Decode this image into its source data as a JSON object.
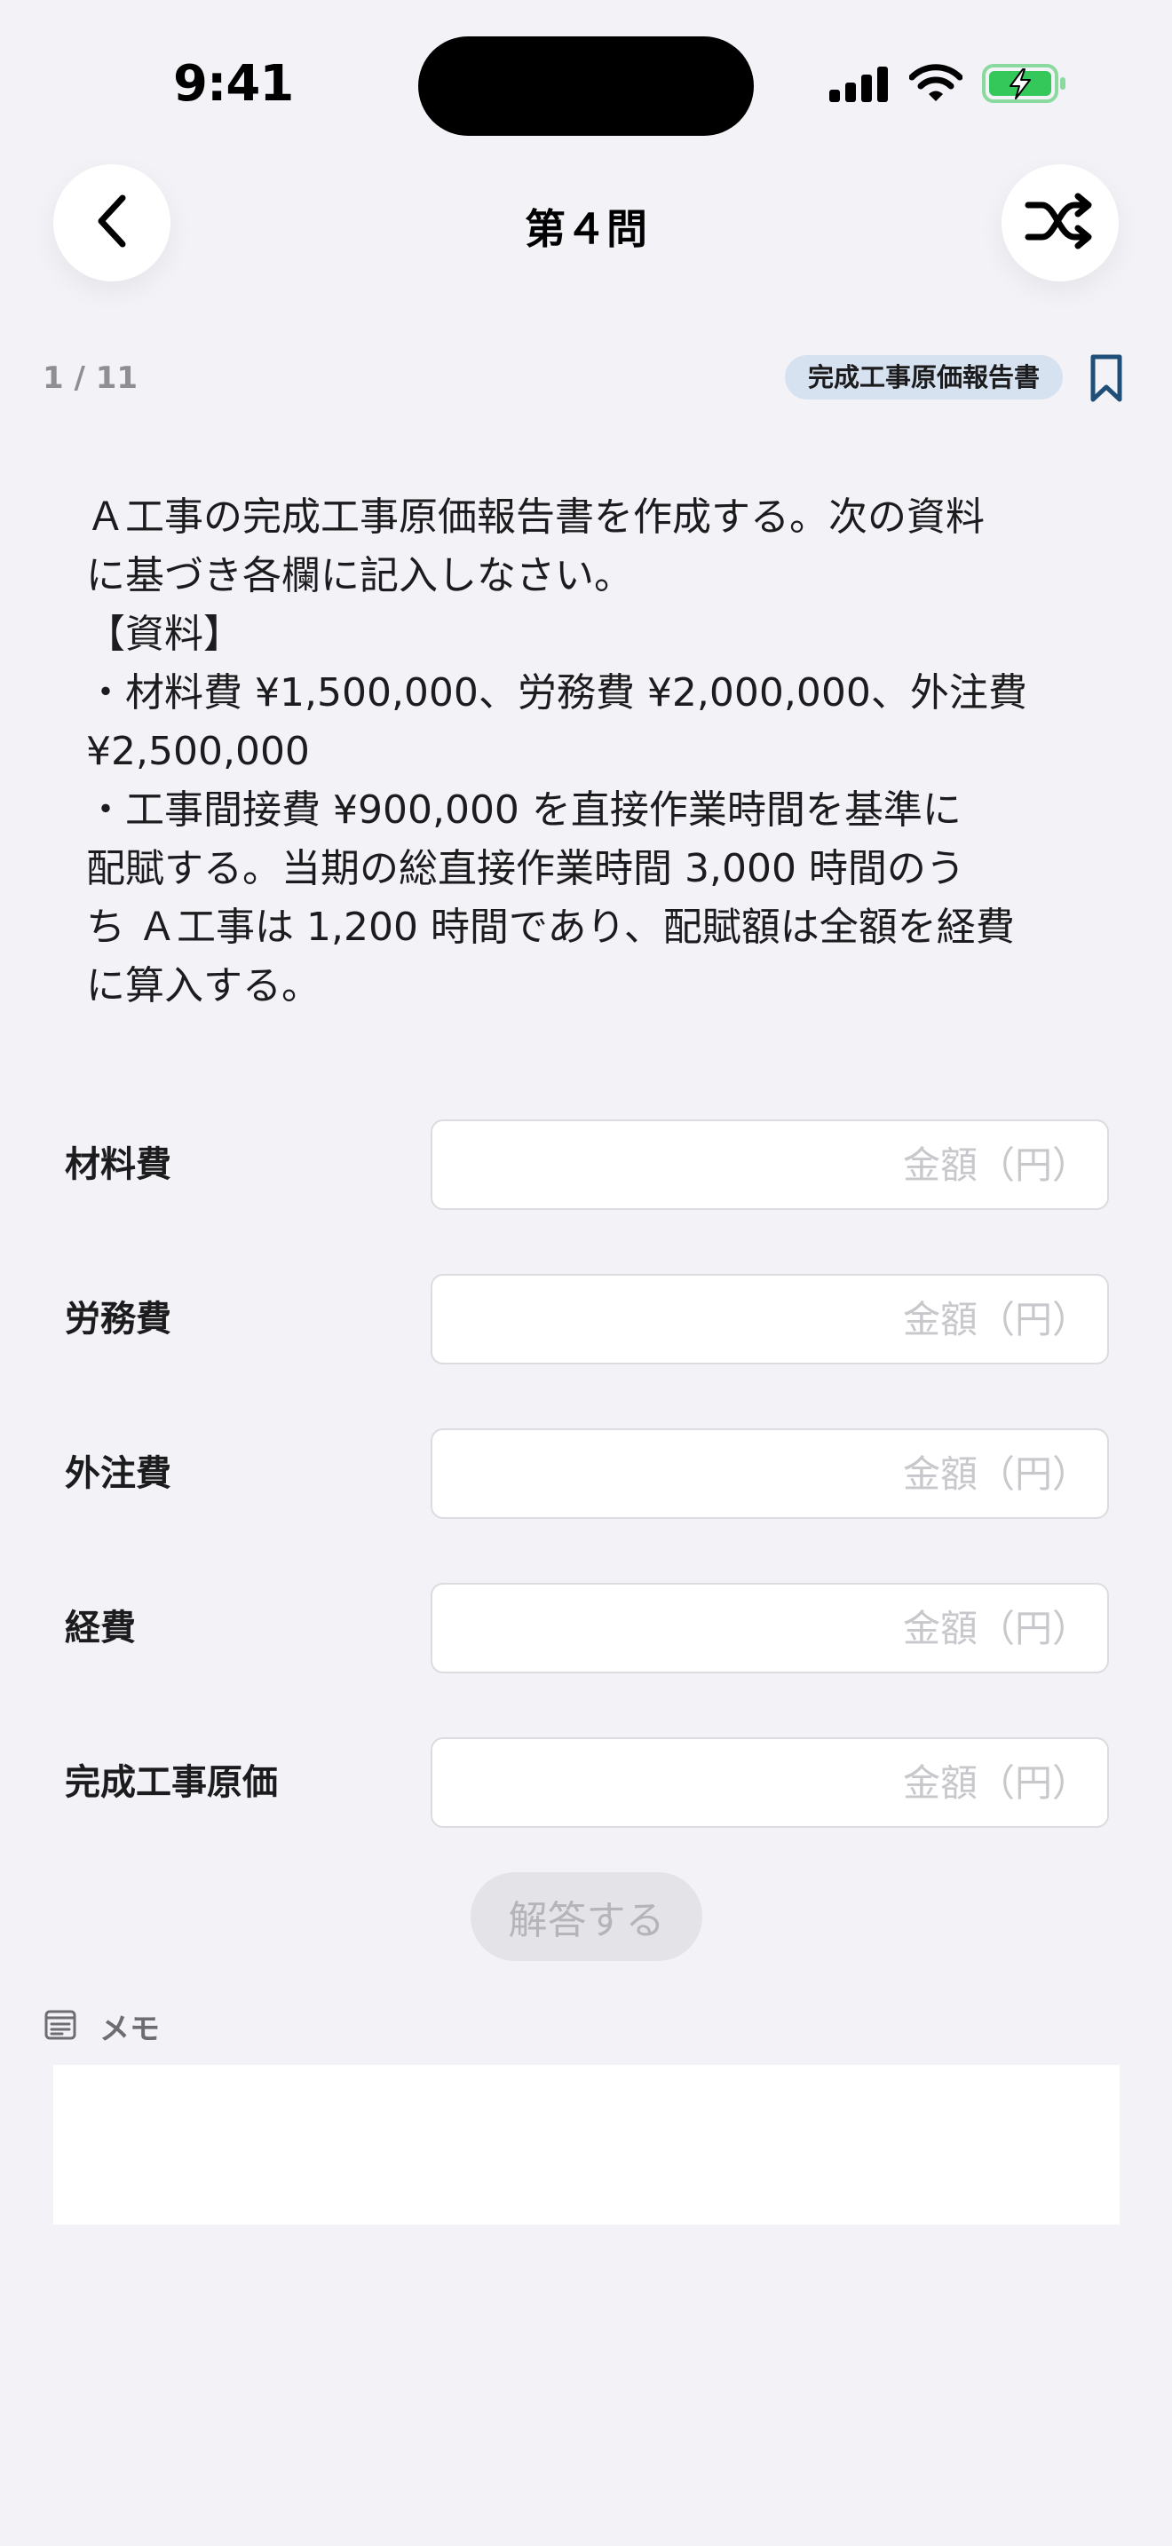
{
  "status_bar": {
    "time": "9:41",
    "icons": [
      "cellular-signal-icon",
      "wifi-icon",
      "battery-charging-icon"
    ],
    "battery_color": "#34c759"
  },
  "nav": {
    "title": "第４問",
    "back_icon": "chevron-left-icon",
    "shuffle_icon": "shuffle-icon"
  },
  "meta": {
    "counter": "1 / 11",
    "tag": "完成工事原価報告書",
    "bookmark_icon": "bookmark-icon",
    "accent_color": "#1f4e79"
  },
  "question": {
    "text": "Ａ工事の完成工事原価報告書を作成する。次の資料\nに基づき各欄に記入しなさい。\n【資料】\n・材料費 ¥1,500,000、労務費 ¥2,000,000、外注費\n¥2,500,000\n・工事間接費 ¥900,000 を直接作業時間を基準に\n配賦する。当期の総直接作業時間 3,000 時間のう\nち Ａ工事は 1,200 時間であり、配賦額は全額を経費\nに算入する。"
  },
  "form": {
    "fields": [
      {
        "label": "材料費",
        "value": "",
        "placeholder": "金額（円）"
      },
      {
        "label": "労務費",
        "value": "",
        "placeholder": "金額（円）"
      },
      {
        "label": "外注費",
        "value": "",
        "placeholder": "金額（円）"
      },
      {
        "label": "経費",
        "value": "",
        "placeholder": "金額（円）"
      },
      {
        "label": "完成工事原価",
        "value": "",
        "placeholder": "金額（円）"
      }
    ],
    "submit_label": "解答する",
    "submit_enabled": false
  },
  "memo": {
    "label": "メモ",
    "icon": "note-icon",
    "value": ""
  }
}
